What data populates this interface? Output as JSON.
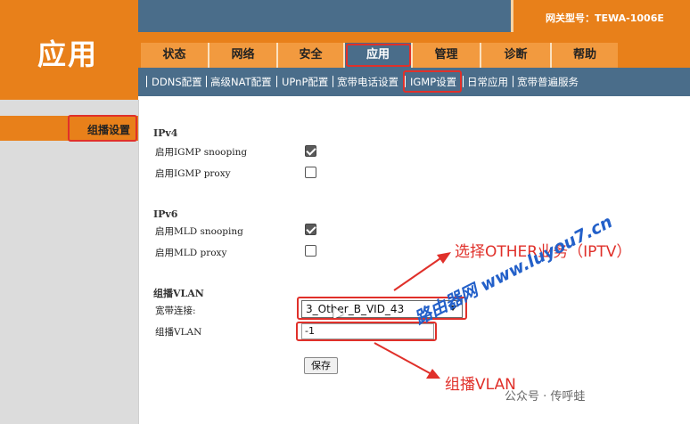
{
  "header": {
    "app_title": "应用",
    "model_label": "网关型号：TEWA-1006E"
  },
  "nav": {
    "items": [
      {
        "label": "状态"
      },
      {
        "label": "网络"
      },
      {
        "label": "安全"
      },
      {
        "label": "应用"
      },
      {
        "label": "管理"
      },
      {
        "label": "诊断"
      },
      {
        "label": "帮助"
      }
    ],
    "active": "应用"
  },
  "subnav": {
    "items": [
      {
        "label": "DDNS配置"
      },
      {
        "label": "高级NAT配置"
      },
      {
        "label": "UPnP配置"
      },
      {
        "label": "宽带电话设置"
      },
      {
        "label": "IGMP设置"
      },
      {
        "label": "日常应用"
      },
      {
        "label": "宽带普遍服务"
      }
    ],
    "active": "IGMP设置"
  },
  "sidebar": {
    "items": [
      {
        "label": "组播设置"
      }
    ]
  },
  "form": {
    "ipv4": {
      "title": "IPv4",
      "igmp_snooping_label": "启用IGMP snooping",
      "igmp_snooping_checked": true,
      "igmp_proxy_label": "启用IGMP proxy",
      "igmp_proxy_checked": false
    },
    "ipv6": {
      "title": "IPv6",
      "mld_snooping_label": "启用MLD snooping",
      "mld_snooping_checked": true,
      "mld_proxy_label": "启用MLD proxy",
      "mld_proxy_checked": false
    },
    "vlan": {
      "title": "组播VLAN",
      "wan_label": "宽带连接:",
      "wan_value": "3_Other_B_VID_43",
      "vlan_label": "组播VLAN",
      "vlan_value": "-1"
    },
    "save_label": "保存"
  },
  "annotations": {
    "select_other": "选择OTHER业务（IPTV）",
    "multicast_vlan": "组播VLAN",
    "watermark": "路由器网 www.luyou7.cn",
    "wechat": "公众号 · 传呼蛙"
  },
  "colors": {
    "orange": "#e8801a",
    "blue_gray": "#4a6d8a",
    "highlight_red": "#e0302a",
    "watermark_blue": "#2360c9"
  }
}
